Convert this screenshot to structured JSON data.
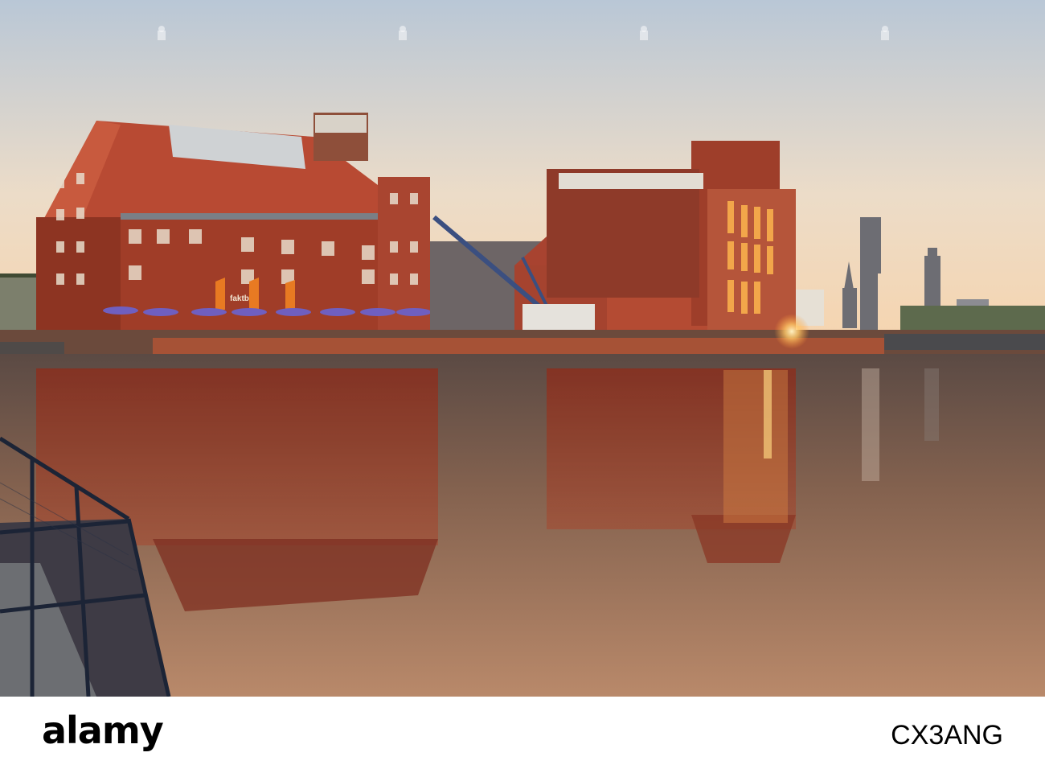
{
  "photo": {
    "sign_text": "faktb"
  },
  "footer": {
    "brand": "alamy",
    "image_id": "CX3ANG"
  },
  "colors": {
    "sky_top": "#b9c8d8",
    "sky_bottom": "#f6d8b4",
    "brick": "#a2402c",
    "water": "#6e4a3a",
    "sun": "#ffd27a"
  }
}
